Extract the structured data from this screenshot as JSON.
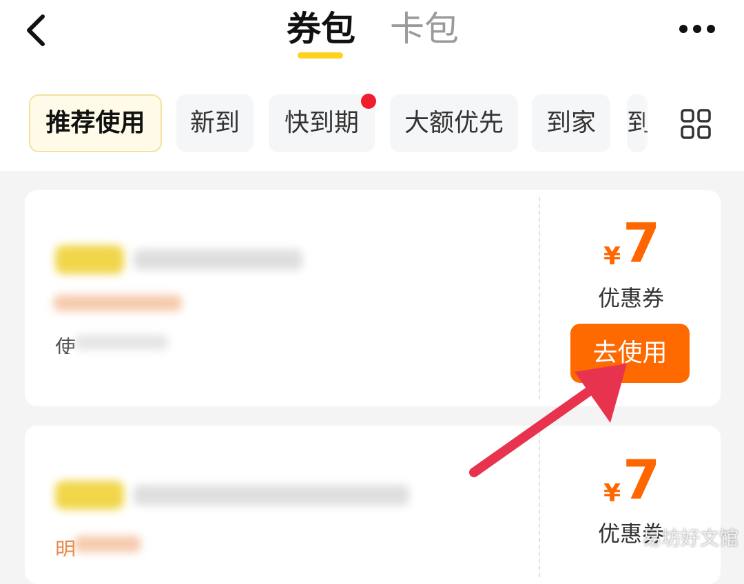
{
  "header": {
    "tabs": [
      {
        "label": "券包",
        "active": true
      },
      {
        "label": "卡包",
        "active": false
      }
    ],
    "back_icon": "chevron-left-icon",
    "more_icon": "more-dots-icon"
  },
  "filters": {
    "chips": [
      "推荐使用",
      "新到",
      "快到期",
      "大额优先",
      "到家"
    ],
    "partial_chip": "到",
    "selected": "推荐使用",
    "unread_dot_on": "快到期",
    "grid_icon": "grid-icon"
  },
  "coupons": [
    {
      "currency": "¥",
      "amount": "7",
      "type": "优惠券",
      "action": "去使用",
      "clipped_text": "使"
    },
    {
      "currency": "¥",
      "amount": "7",
      "type": "优惠券",
      "clipped_text": "明"
    }
  ],
  "watermark": "易坊好文馆",
  "colors": {
    "accent": "#ff6a00",
    "tab_underline": "#ffd21e",
    "dot": "#f01d2c",
    "arrow": "#e8334f"
  }
}
